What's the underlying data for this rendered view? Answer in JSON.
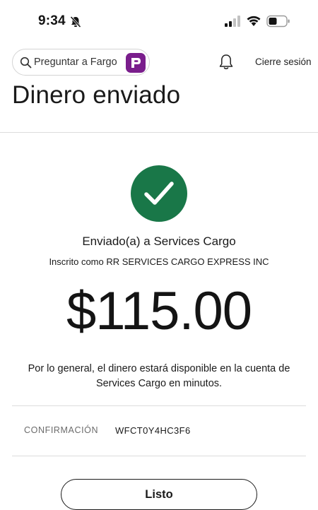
{
  "status_bar": {
    "time": "9:34",
    "icons": [
      "bell-slash-icon",
      "cellular-signal-icon",
      "wifi-icon",
      "battery-icon"
    ]
  },
  "header": {
    "search_label": "Preguntar a Fargo",
    "search_icon": "search-icon",
    "assistant_icon": "fargo-assistant-icon",
    "notifications_icon": "bell-icon",
    "logout_label": "Cierre sesión"
  },
  "page": {
    "title": "Dinero enviado"
  },
  "result": {
    "status_icon": "checkmark-icon",
    "sent_to": "Enviado(a) a Services Cargo",
    "registered_as": "Inscrito como RR SERVICES CARGO EXPRESS INC",
    "amount": "$115.00",
    "availability_note": "Por lo general, el dinero estará disponible en la cuenta de Services Cargo en minutos."
  },
  "confirmation": {
    "label": "CONFIRMACIÓN",
    "value": "WFCT0Y4HC3F6"
  },
  "actions": {
    "done_label": "Listo"
  },
  "colors": {
    "success_green": "#197748",
    "fargo_purple": "#7a1e8c",
    "divider": "#dcdcdc"
  }
}
